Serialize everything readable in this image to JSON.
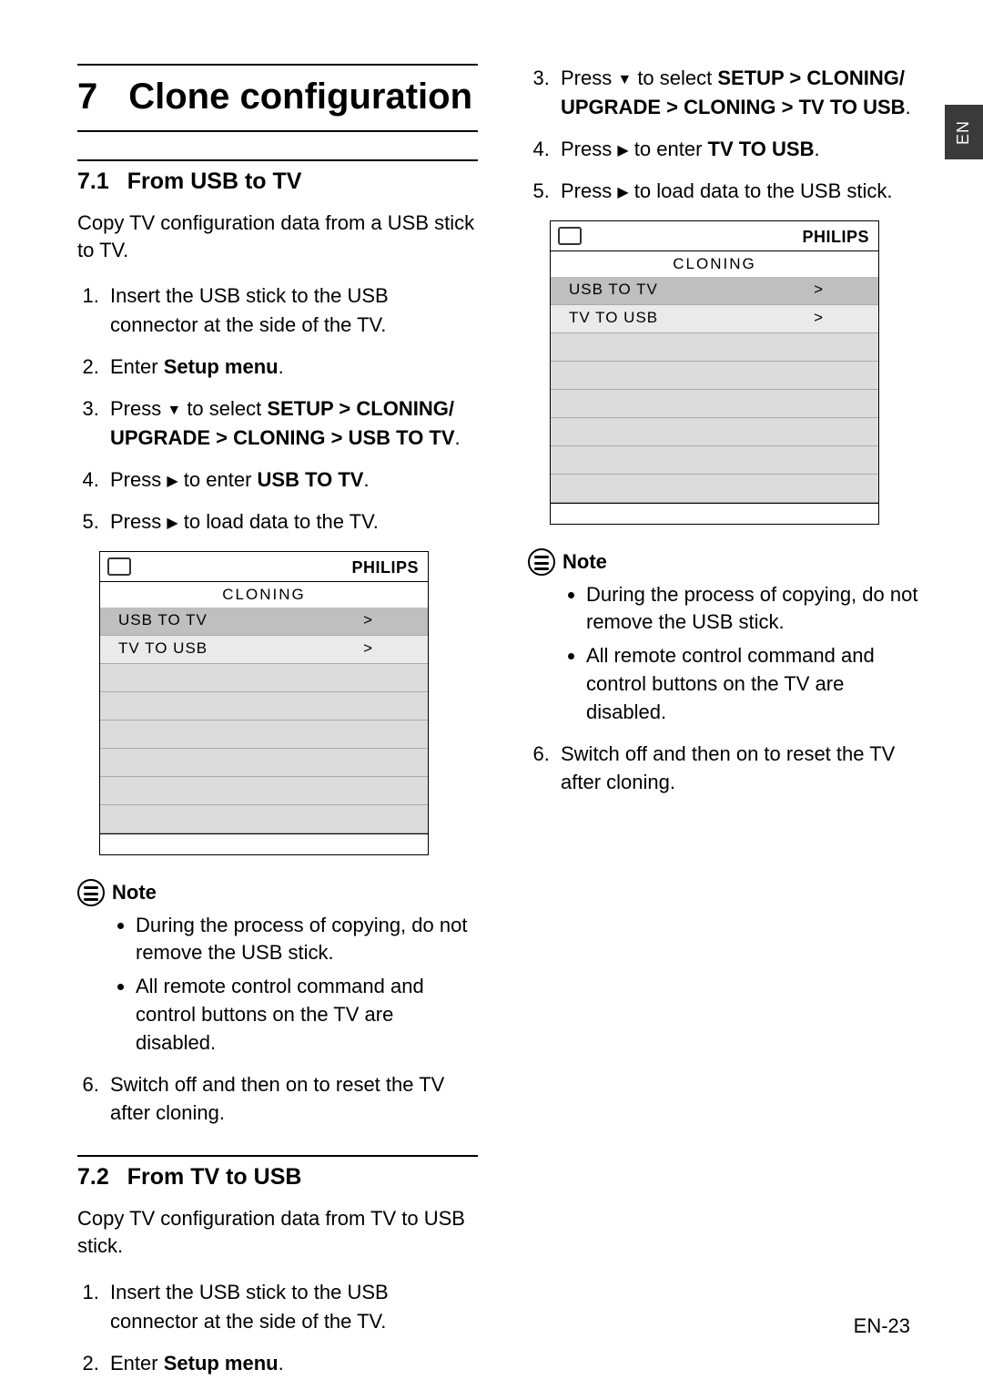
{
  "lang_tab": "EN",
  "page_number": "EN-23",
  "chapter": {
    "number": "7",
    "title": "Clone configuration"
  },
  "icons": {
    "down": "▼",
    "right": "▶"
  },
  "sections": [
    {
      "number": "7.1",
      "title": "From USB to TV",
      "intro": "Copy TV configuration data from a USB stick to TV.",
      "steps": [
        "Insert the USB stick to the USB connector at the side of the TV.",
        {
          "prefix": "Enter ",
          "bold": "Setup menu",
          "suffix": "."
        },
        {
          "press_dir": "down",
          "select_path": "SETUP > CLONING/ UPGRADE > CLONING > USB TO TV"
        },
        {
          "press_dir": "right",
          "enter_label": "USB TO TV"
        },
        {
          "press_dir": "right",
          "load_text": " to load data to the TV."
        }
      ],
      "screenshot": {
        "brand": "PHILIPS",
        "title": "CLONING",
        "rows": [
          {
            "label": "USB TO TV",
            "value": ">",
            "selected": true
          },
          {
            "label": "TV TO USB",
            "value": ">",
            "selected": false
          }
        ],
        "blank_rows": 6
      },
      "note": {
        "heading": "Note",
        "bullets": [
          "During the process of copying, do not remove the USB stick.",
          "All remote control command and control buttons on the TV are disabled."
        ]
      },
      "after_note_step_start": 6,
      "after_note_steps": [
        "Switch off and then on to reset the TV after cloning."
      ]
    },
    {
      "number": "7.2",
      "title": "From TV to USB",
      "intro": "Copy TV configuration data from TV to USB stick.",
      "steps": [
        "Insert the USB stick to the USB connector at the side of the TV.",
        {
          "prefix": "Enter ",
          "bold": "Setup menu",
          "suffix": "."
        }
      ]
    }
  ],
  "right_col": {
    "step_start": 3,
    "steps": [
      {
        "press_dir": "down",
        "select_path": "SETUP > CLONING/ UPGRADE > CLONING > TV TO USB"
      },
      {
        "press_dir": "right",
        "enter_label": "TV TO USB"
      },
      {
        "press_dir": "right",
        "load_text": " to load data to the USB stick."
      }
    ],
    "screenshot": {
      "brand": "PHILIPS",
      "title": "CLONING",
      "rows": [
        {
          "label": "USB TO TV",
          "value": ">",
          "selected": true
        },
        {
          "label": "TV TO USB",
          "value": ">",
          "selected": false
        }
      ],
      "blank_rows": 6
    },
    "note": {
      "heading": "Note",
      "bullets": [
        "During the process of copying, do not remove the USB stick.",
        "All remote control command and control buttons on the TV are disabled."
      ]
    },
    "after_note_step_start": 6,
    "after_note_steps": [
      "Switch off and then on to reset the TV after cloning."
    ]
  }
}
